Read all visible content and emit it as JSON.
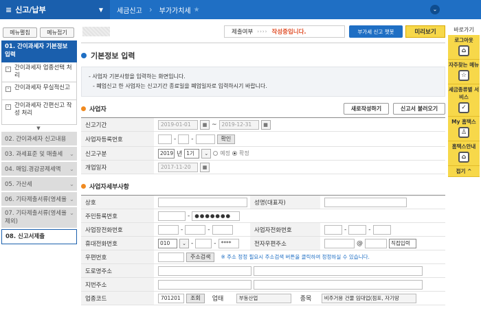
{
  "topbar": {
    "menu_title": "신고/납부",
    "crumb1": "세금신고",
    "crumb2": "부가가치세"
  },
  "sidebar": {
    "expand": "메뉴펼침",
    "collapse": "메뉴접기",
    "active_step": "01. 간이과세자 기본정보 입력",
    "subs": [
      "간이과세자 업종선택 처리",
      "간이과세자 무실적신고",
      "간이과세자 간편신고 작성 처리"
    ],
    "steps": [
      "02. 간이과세자 신고내용",
      "03. 과세표준 및 매출세",
      "04. 매입.경감공제세액",
      "05. 가산세",
      "06. 기타제출서류(영세율",
      "07. 기타제출서류(영세율 제외)"
    ],
    "last_step": "08. 신고서제출"
  },
  "status": {
    "label": "제출여부",
    "arrows": "››››",
    "value": "작성중입니다.",
    "chat": "부가세 신고 챗봇",
    "preview": "미리보기"
  },
  "main": {
    "title": "기본정보 입력",
    "notice1": "- 사업자 기본사항을 입력하는 화면입니다.",
    "notice2": "- 폐업신고 한 사업자는 신고기간 종료일을 폐업일자로 입력하시기 바랍니다.",
    "biz_head": "사업자",
    "new_btn": "새로작성하기",
    "load_btn": "신고서 불러오기",
    "period_lbl": "신고기간",
    "period_from": "2019-01-01",
    "tilde": "~",
    "period_to": "2019-12-31",
    "regno_lbl": "사업자등록번호",
    "confirm": "확인",
    "type_lbl": "신고구분",
    "year": "2019",
    "year_unit": "년",
    "term": "1기",
    "r1": "예정",
    "r2": "확정",
    "open_lbl": "개업일자",
    "open_date": "2017-11-20",
    "detail_head": "사업자세부사항",
    "name_lbl": "상호",
    "rep_lbl": "성명(대표자)",
    "rrn_lbl": "주민등록번호",
    "rrn_mask": "●●●●●●●",
    "biztel_lbl": "사업장전화번호",
    "home_lbl": "사업자전화번호",
    "mobile_lbl": "휴대전화번호",
    "mobile_prefix": "010",
    "mobile_mask": "****",
    "email_lbl": "전자우편주소",
    "at": "@",
    "direct": "직접입력",
    "post_lbl": "우편번호",
    "post_btn": "주소검색",
    "post_note": "※ 주소 정정 필요시 주소검색 버튼을 클릭하여 정정하실 수 있습니다.",
    "road_lbl": "도로명주소",
    "jibun_lbl": "지번주소",
    "industry_lbl": "업종코드",
    "industry_code": "701201",
    "lookup": "조회",
    "type2_lbl": "업태",
    "type2_val": "부동산업",
    "item_lbl": "종목",
    "item_val": "비주거용 건물 임대업(점포, 자기땅"
  },
  "right_panel": {
    "title": "바로가기",
    "items": [
      "로그아웃",
      "자주찾는 메뉴",
      "세금종류별 서비스",
      "My 홈택스",
      "홈택스안내"
    ],
    "fold": "접기"
  }
}
